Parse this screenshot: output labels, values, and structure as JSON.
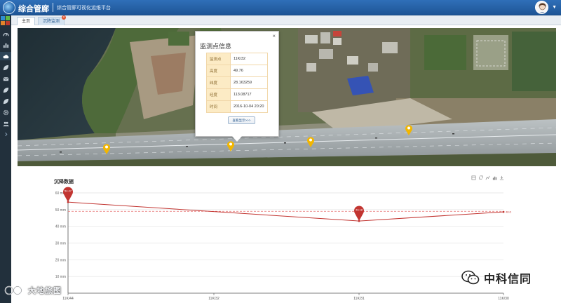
{
  "header": {
    "title": "综合管廊",
    "subtitle": "综合管廊可视化运维平台",
    "avatar_icon": "user-avatar-icon"
  },
  "sidebar": {
    "items": [
      {
        "icon": "speedometer-icon"
      },
      {
        "icon": "bar-chart-icon"
      },
      {
        "icon": "cloud-icon"
      },
      {
        "icon": "leaf-icon"
      },
      {
        "icon": "envelope-icon"
      },
      {
        "icon": "leaf-icon"
      },
      {
        "icon": "leaf-icon"
      },
      {
        "icon": "gear-icon"
      },
      {
        "icon": "users-icon"
      },
      {
        "icon": "chevron-right-icon"
      }
    ]
  },
  "tabs": [
    {
      "label": "主页",
      "active": true
    },
    {
      "label": "沉降监测",
      "active": false,
      "closable": true
    }
  ],
  "popup": {
    "title": "监测点信息",
    "close_label": "×",
    "rows": [
      {
        "key": "监测点",
        "value": "11K/32"
      },
      {
        "key": "高度",
        "value": "49.76"
      },
      {
        "key": "纬度",
        "value": "28.163259"
      },
      {
        "key": "经度",
        "value": "113.08717"
      },
      {
        "key": "时间",
        "value": "2016-10-04 20:20"
      }
    ],
    "button_label": "查看显示>>>"
  },
  "section": {
    "title": "沉降数据",
    "toolbox": [
      "zoom-icon",
      "zoom-reset-icon",
      "line-chart-icon",
      "bar-chart-icon",
      "download-icon"
    ]
  },
  "chart_data": {
    "type": "line",
    "categories": [
      "11K/44",
      "11K/32",
      "11K/31",
      "11K/30"
    ],
    "x_positions_frac": null,
    "series": [
      {
        "values": [
          54.47,
          null,
          43.18,
          48.6
        ]
      }
    ],
    "point_labels": [
      {
        "category": "11K/44",
        "label": "54.47",
        "style": "pin"
      },
      {
        "category": "11K/31",
        "label": "43.18",
        "style": "pin"
      },
      {
        "category": "11K/30",
        "label": "48.6",
        "style": "text"
      }
    ],
    "mean_line": 49,
    "yticks": [
      {
        "value": 10,
        "label": "10 mm"
      },
      {
        "value": 20,
        "label": "20 mm"
      },
      {
        "value": 30,
        "label": "30 mm"
      },
      {
        "value": 40,
        "label": "40 mm"
      },
      {
        "value": 50,
        "label": "50 mm"
      },
      {
        "value": 60,
        "label": "60 mm"
      }
    ],
    "ylim": [
      0,
      60
    ],
    "grid": true,
    "colors": {
      "series": "#c23531",
      "mean": "#e56b6b",
      "grid": "#e3e3e3",
      "axis": "#555555"
    }
  },
  "watermarks": {
    "left": "大地旅图",
    "right": "中科信同"
  },
  "colors": {
    "header_bg": "#2160a6",
    "sidebar_bg": "#22303c",
    "pin": "#f2b600",
    "popup_key_bg": "#fcebc5"
  }
}
